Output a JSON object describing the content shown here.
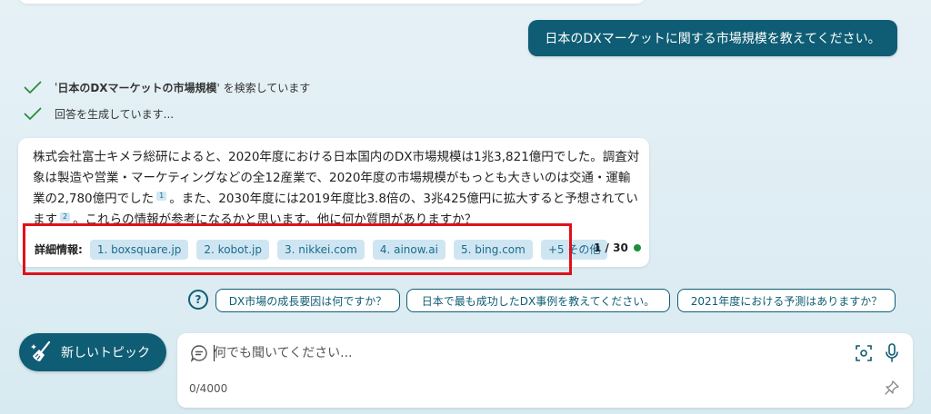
{
  "user_message": "日本のDXマーケットに関する市場規模を教えてください。",
  "status": {
    "search_prefix": "'",
    "search_term": "日本のDXマーケットの市場規模",
    "search_suffix": "' を検索しています",
    "generating": "回答を生成しています..."
  },
  "answer": {
    "part1": "株式会社富士キメラ総研によると、2020年度における日本国内のDX市場規模は1兆3,821億円でした。調査対象は製造や営業・マーケティングなどの全12産業で、2020年度の市場規模がもっとも大きいのは交通・運輸業の2,780億円でした",
    "cite1": "1",
    "part2": "。また、2030年度には2019年度比3.8倍の、3兆425億円に拡大すると予想されています",
    "cite2": "2",
    "part3": "。これらの情報が参考になるかと思います。他に何か質問がありますか？"
  },
  "sources": {
    "label": "詳細情報:",
    "items": [
      "1. boxsquare.jp",
      "2. kobot.jp",
      "3. nikkei.com",
      "4. ainow.ai",
      "5. bing.com",
      "+5 その他"
    ]
  },
  "page_count": "1 / 30",
  "suggestions": [
    "DX市場の成長要因は何ですか？",
    "日本で最も成功したDX事例を教えてください。",
    "2021年度における予測はありますか？"
  ],
  "new_topic_label": "新しいトピック",
  "input": {
    "placeholder": "何でも聞いてください...",
    "char_count": "0/4000"
  },
  "colors": {
    "accent": "#0f5d74",
    "chip_bg": "#cfe6f2",
    "highlight": "#e0101a",
    "status_dot": "#1e8e3e",
    "check": "#2e8b3e"
  }
}
